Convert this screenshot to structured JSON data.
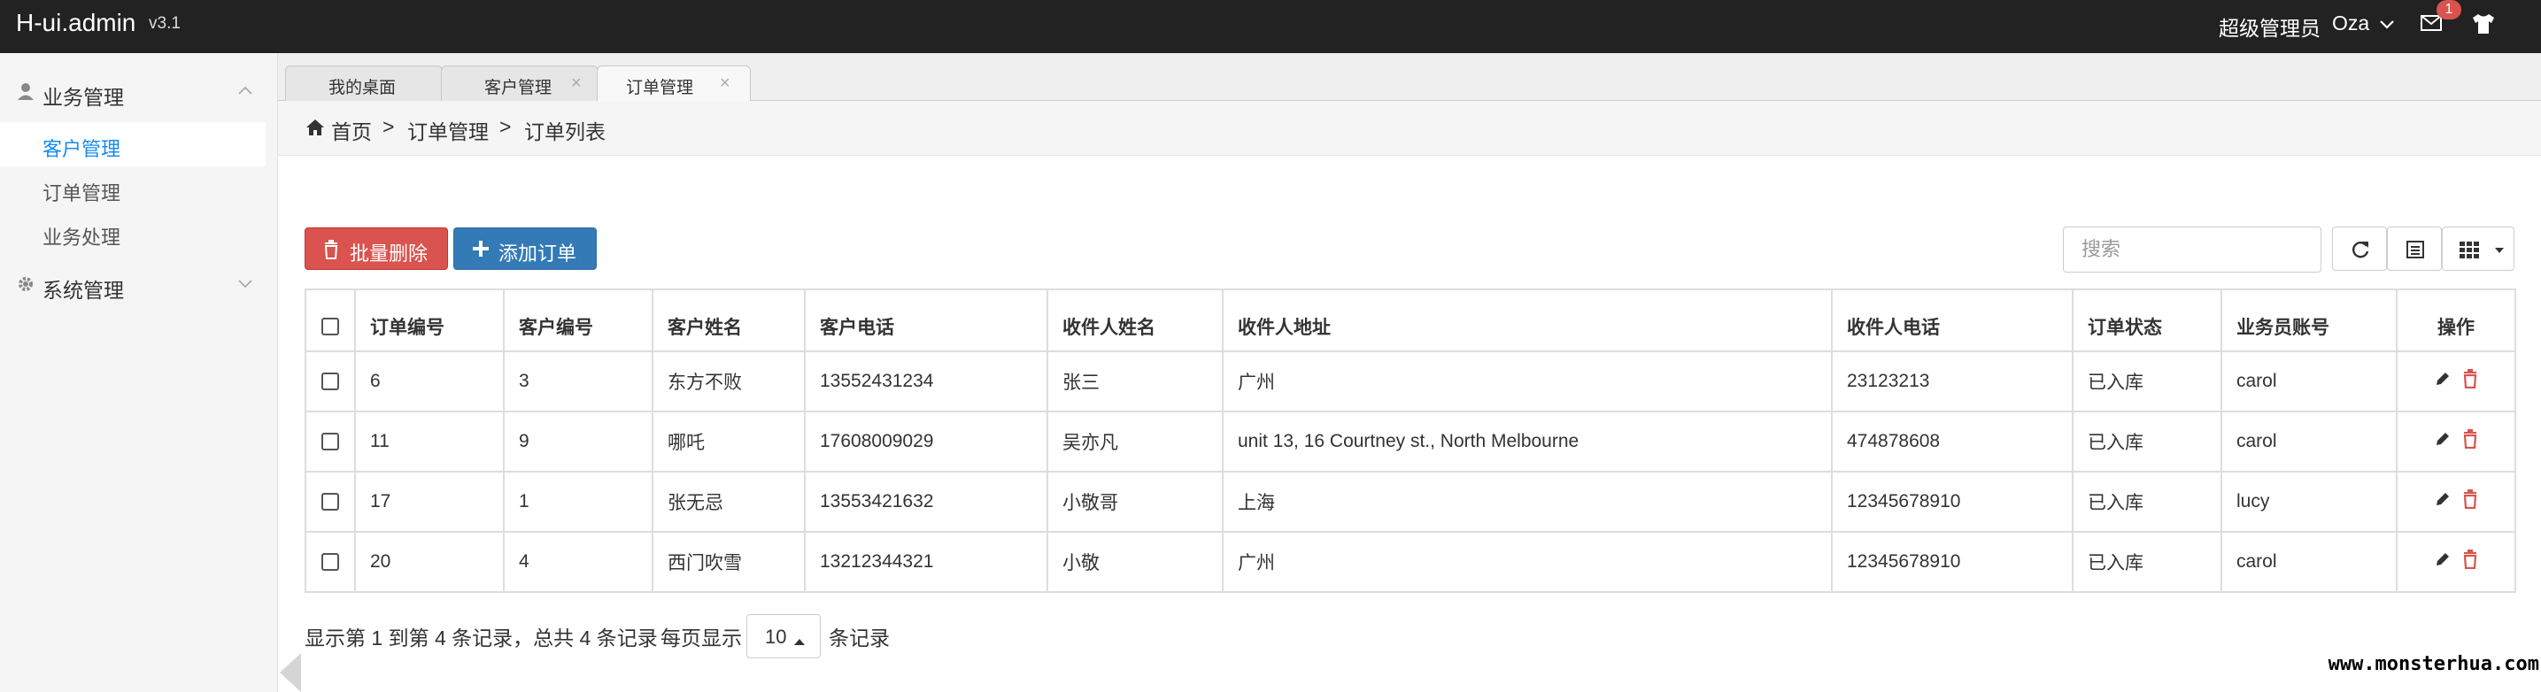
{
  "app": {
    "brand": "H-ui.admin",
    "version": "v3.1"
  },
  "topbar": {
    "role": "超级管理员",
    "user": "Oza",
    "mail_badge": "1",
    "mail_icon": "envelope-icon",
    "skin_icon": "tshirt-icon"
  },
  "sidebar": {
    "groups": [
      {
        "label": "业务管理",
        "icon": "user-icon",
        "expanded": true,
        "items": [
          {
            "label": "客户管理",
            "active": true
          },
          {
            "label": "订单管理",
            "active": false
          },
          {
            "label": "业务处理",
            "active": false
          }
        ]
      },
      {
        "label": "系统管理",
        "icon": "gear-icon",
        "expanded": false,
        "items": []
      }
    ]
  },
  "tabs": [
    {
      "label": "我的桌面",
      "closable": false,
      "active": false
    },
    {
      "label": "客户管理",
      "closable": true,
      "active": false
    },
    {
      "label": "订单管理",
      "closable": true,
      "active": true
    }
  ],
  "tab_close_glyph": "×",
  "breadcrumb": {
    "items": [
      "首页",
      "订单管理",
      "订单列表"
    ],
    "separator": ">"
  },
  "toolbar": {
    "batch_delete": "批量删除",
    "add_order": "添加订单",
    "search_placeholder": "搜索"
  },
  "table": {
    "columns": [
      "订单编号",
      "客户编号",
      "客户姓名",
      "客户电话",
      "收件人姓名",
      "收件人地址",
      "收件人电话",
      "订单状态",
      "业务员账号",
      "操作"
    ],
    "rows": [
      [
        "6",
        "3",
        "东方不败",
        "13552431234",
        "张三",
        "广州",
        "23123213",
        "已入库",
        "carol"
      ],
      [
        "11",
        "9",
        "哪吒",
        "17608009029",
        "吴亦凡",
        "unit 13, 16 Courtney st., North Melbourne",
        "474878608",
        "已入库",
        "carol"
      ],
      [
        "17",
        "1",
        "张无忌",
        "13553421632",
        "小敬哥",
        "上海",
        "12345678910",
        "已入库",
        "lucy"
      ],
      [
        "20",
        "4",
        "西门吹雪",
        "13212344321",
        "小敬",
        "广州",
        "12345678910",
        "已入库",
        "carol"
      ]
    ]
  },
  "pagination": {
    "summary": "显示第 1 到第 4 条记录，总共 4 条记录",
    "per_page_prefix": "每页显示",
    "page_size": "10",
    "per_page_suffix": "条记录"
  },
  "watermark": "www.monsterhua.com",
  "colors": {
    "topbar": "#222222",
    "accent": "#148cf1",
    "danger": "#d9534f",
    "primary": "#337ab7"
  }
}
